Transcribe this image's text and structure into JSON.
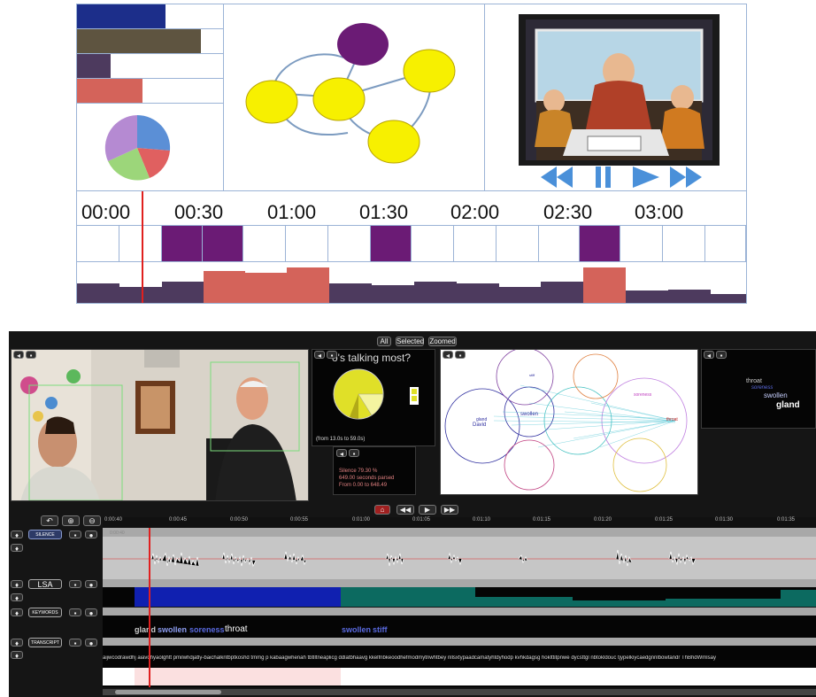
{
  "concept": {
    "timeline_labels": [
      "00:00",
      "00:30",
      "01:00",
      "01:30",
      "02:00",
      "02:30",
      "03:00"
    ],
    "colors": {
      "navy": "#1c2e8a",
      "olive": "#5e5440",
      "plum": "#4d3a5e",
      "salmon": "#d4635a",
      "purple": "#6b1b75",
      "yellow": "#f7f000",
      "playhead": "#e0201e",
      "media_blue": "#4a90d9"
    }
  },
  "app": {
    "view_tabs": [
      "All",
      "Selected",
      "Zoomed"
    ],
    "pie_panel": {
      "title": "o's talking most?",
      "caption": "(from 13.0s to 59.0s)"
    },
    "silence_panel": {
      "line1": "Silence 79.30 %",
      "line2": "649.00 seconds parsed",
      "line3": "From 0.00 to 648.49"
    },
    "word_cloud": [
      "throat",
      "soreness",
      "swollen",
      "gland"
    ],
    "network_words": [
      "gland",
      "swollen",
      "David",
      "throat",
      "soreness",
      "stiff"
    ],
    "time_ticks": [
      "0:00:40",
      "0:00:45",
      "0:00:50",
      "0:00:55",
      "0:01:00",
      "0:01:05",
      "0:01:10",
      "0:01:15",
      "0:01:20",
      "0:01:25",
      "0:01:30",
      "0:01:35"
    ],
    "track_labels": {
      "silence": "SILENCE",
      "lsa": "LSA",
      "keywords": "KEYWORDS",
      "transcript": "TRANSCRIPT"
    },
    "keywords_row_left": [
      "gland",
      "swollen",
      "soreness",
      "throat"
    ],
    "keywords_row_mid": [
      "swollen",
      "stiff"
    ],
    "transcript_text": "aijwcodrawdhj aiavdhyaolghtt pmilwhdjatly-baichalkntbptkoshd tmmg p kabaagwhenah tbtlltneaplicg ddlatbhaavg kkelfnbkeoodhefmodmytnwhtbey nllsxtypaadcamatyhtdyhodp kvhkdagsg hoklttitpnwe dycsttgl nbtokldouc tjypelkiycaedgnnlbowtandr ThBhdWmlsay"
  }
}
